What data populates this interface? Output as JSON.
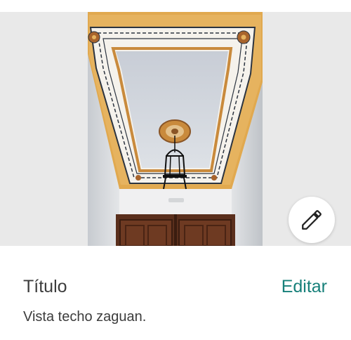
{
  "photo": {
    "alt": "Vista techo zaguan."
  },
  "fab": {
    "icon": "pencil-icon"
  },
  "details": {
    "title_label": "Título",
    "edit_label": "Editar",
    "description": "Vista techo zaguan."
  },
  "colors": {
    "accent": "#17807a",
    "text": "#3c3c3c",
    "backdrop": "#e9e9e9"
  }
}
